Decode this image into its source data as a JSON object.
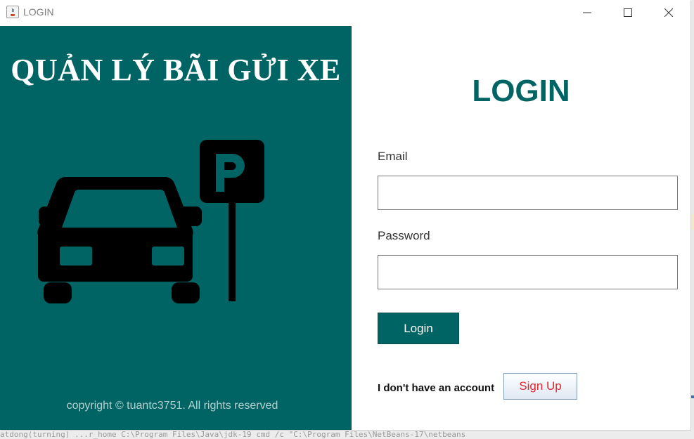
{
  "window": {
    "title": "LOGIN",
    "controls": [
      "minimize-icon",
      "maximize-icon",
      "close-icon"
    ]
  },
  "left_panel": {
    "brand_title": "QUẢN LÝ BÃI GỬI XE",
    "illustration": "car-parking-icon",
    "copyright": "copyright © tuantc3751. All rights reserved"
  },
  "login_form": {
    "heading": "LOGIN",
    "email_label": "Email",
    "email_value": "",
    "password_label": "Password",
    "password_value": "",
    "login_button": "Login",
    "no_account_text": "I don't have an account",
    "signup_button": "Sign Up"
  },
  "background": {
    "console_text": "atdong(turning) ...r_home C:\\Program Files\\Java\\jdk-19 cmd /c \"C:\\Program Files\\NetBeans-17\\netbeans"
  },
  "colors": {
    "primary": "#006464",
    "signup_text": "#e0282f",
    "white": "#ffffff"
  }
}
